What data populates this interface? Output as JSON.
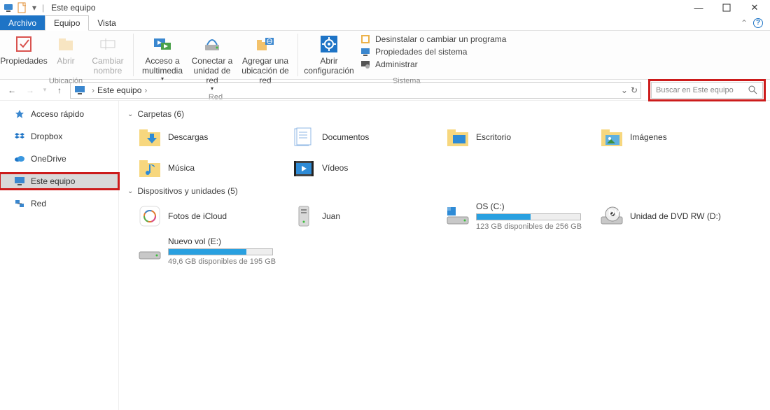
{
  "window": {
    "title": "Este equipo"
  },
  "tabs": {
    "file": "Archivo",
    "equipo": "Equipo",
    "vista": "Vista"
  },
  "ribbon": {
    "propiedades": "Propiedades",
    "abrir": "Abrir",
    "cambiar_nombre": "Cambiar\nnombre",
    "ubicacion_label": "Ubicación",
    "acceso_multimedia": "Acceso a\nmultimedia",
    "conectar_unidad": "Conectar a\nunidad de red",
    "agregar_ubicacion": "Agregar una\nubicación de red",
    "red_label": "Red",
    "abrir_config": "Abrir\nconfiguración",
    "desinstalar": "Desinstalar o cambiar un programa",
    "prop_sistema": "Propiedades del sistema",
    "administrar": "Administrar",
    "sistema_label": "Sistema"
  },
  "address": {
    "crumb": "Este equipo",
    "search_placeholder": "Buscar en Este equipo"
  },
  "sidebar": {
    "quick_access": "Acceso rápido",
    "dropbox": "Dropbox",
    "onedrive": "OneDrive",
    "este_equipo": "Este equipo",
    "red": "Red"
  },
  "content": {
    "folders_header": "Carpetas (6)",
    "devices_header": "Dispositivos y unidades (5)",
    "folders": {
      "descargas": "Descargas",
      "documentos": "Documentos",
      "escritorio": "Escritorio",
      "imagenes": "Imágenes",
      "musica": "Música",
      "videos": "Vídeos"
    },
    "devices": {
      "fotos_icloud": "Fotos de iCloud",
      "juan": "Juan",
      "osc": {
        "label": "OS (C:)",
        "sub": "123 GB disponibles de 256 GB",
        "fill": 52
      },
      "dvd": "Unidad de DVD RW (D:)",
      "nuevovol": {
        "label": "Nuevo vol (E:)",
        "sub": "49,6 GB disponibles de 195 GB",
        "fill": 75
      }
    }
  }
}
